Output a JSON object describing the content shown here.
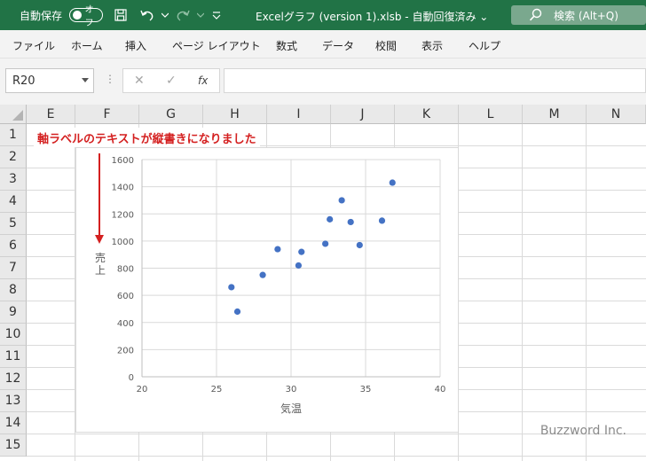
{
  "titlebar": {
    "autosave_label": "自動保存",
    "autosave_state": "オフ",
    "doc_title": "Excelグラフ (version 1).xlsb  -  自動回復済み  ⌄",
    "search_label": "検索 (Alt+Q)"
  },
  "menu": [
    "ファイル",
    "ホーム",
    "挿入",
    "ページ レイアウト",
    "数式",
    "データ",
    "校閲",
    "表示",
    "ヘルプ"
  ],
  "formula_bar": {
    "name_box": "R20",
    "dots": "⋮",
    "cancel": "✕",
    "enter": "✓",
    "fx": "fx",
    "formula": ""
  },
  "grid": {
    "columns": [
      "E",
      "F",
      "G",
      "H",
      "I",
      "J",
      "K",
      "L",
      "M",
      "N"
    ],
    "rows": [
      "1",
      "2",
      "3",
      "4",
      "5",
      "6",
      "7",
      "8",
      "9",
      "10",
      "11",
      "12",
      "13",
      "14",
      "15"
    ]
  },
  "annotation": "軸ラベルのテキストが縦書きになりました",
  "annotation_color": "#d42020",
  "chart_data": {
    "type": "scatter",
    "title": "",
    "xlabel": "気温",
    "ylabel": "売上",
    "xlim": [
      20,
      40
    ],
    "ylim": [
      0,
      1600
    ],
    "xticks": [
      "20",
      "25",
      "30",
      "35",
      "40"
    ],
    "yticks": [
      "0",
      "200",
      "400",
      "600",
      "800",
      "1000",
      "1200",
      "1400",
      "1600"
    ],
    "grid": true,
    "marker_color": "#4472c4",
    "points": [
      {
        "x": 26.0,
        "y": 660
      },
      {
        "x": 26.4,
        "y": 480
      },
      {
        "x": 28.1,
        "y": 750
      },
      {
        "x": 29.1,
        "y": 940
      },
      {
        "x": 30.5,
        "y": 820
      },
      {
        "x": 30.7,
        "y": 920
      },
      {
        "x": 32.3,
        "y": 980
      },
      {
        "x": 32.6,
        "y": 1160
      },
      {
        "x": 33.4,
        "y": 1300
      },
      {
        "x": 34.0,
        "y": 1140
      },
      {
        "x": 34.6,
        "y": 970
      },
      {
        "x": 36.1,
        "y": 1150
      },
      {
        "x": 36.8,
        "y": 1430
      }
    ]
  },
  "watermark": "Buzzword Inc."
}
